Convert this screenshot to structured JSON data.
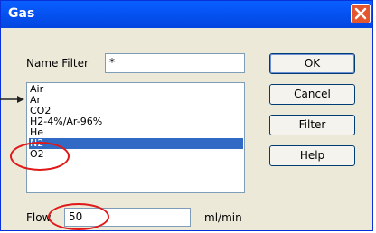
{
  "window": {
    "title": "Gas"
  },
  "name_filter": {
    "label": "Name Filter",
    "value": "*"
  },
  "gas_list": {
    "items": [
      "Air",
      "Ar",
      "CO2",
      "H2-4%/Ar-96%",
      "He",
      "N2",
      "O2"
    ],
    "selected": "N2"
  },
  "flow": {
    "label": "Flow",
    "value": "50",
    "unit": "ml/min"
  },
  "buttons": {
    "ok": "OK",
    "cancel": "Cancel",
    "filter": "Filter",
    "help": "Help"
  },
  "colors": {
    "accent": "#316ac5",
    "annotation": "#e01818",
    "titlebar": "#0553f2"
  }
}
